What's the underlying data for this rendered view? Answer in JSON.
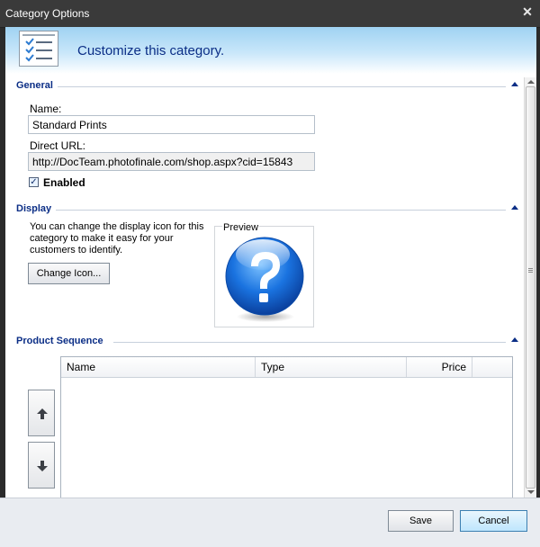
{
  "window": {
    "title": "Category Options"
  },
  "header": {
    "text": "Customize this category.",
    "icon": "checklist-icon"
  },
  "general": {
    "section_title": "General",
    "name_label": "Name:",
    "name_value": "Standard Prints",
    "url_label": "Direct URL:",
    "url_value": "http://DocTeam.photofinale.com/shop.aspx?cid=15843",
    "enabled_label": "Enabled",
    "enabled_checked": true
  },
  "display": {
    "section_title": "Display",
    "description": "You can change the display icon for this category to make it easy for your customers to identify.",
    "change_icon_label": "Change Icon...",
    "preview_label": "Preview",
    "preview_icon": "question-mark-icon"
  },
  "product_sequence": {
    "section_title": "Product Sequence",
    "columns": [
      "Name",
      "Type",
      "Price"
    ],
    "rows": []
  },
  "buttons": {
    "save": "Save",
    "cancel": "Cancel"
  },
  "colors": {
    "accent": "#0b2e86",
    "header_gradient_top": "#9fd2f2",
    "orb_blue": "#1a73e0"
  }
}
